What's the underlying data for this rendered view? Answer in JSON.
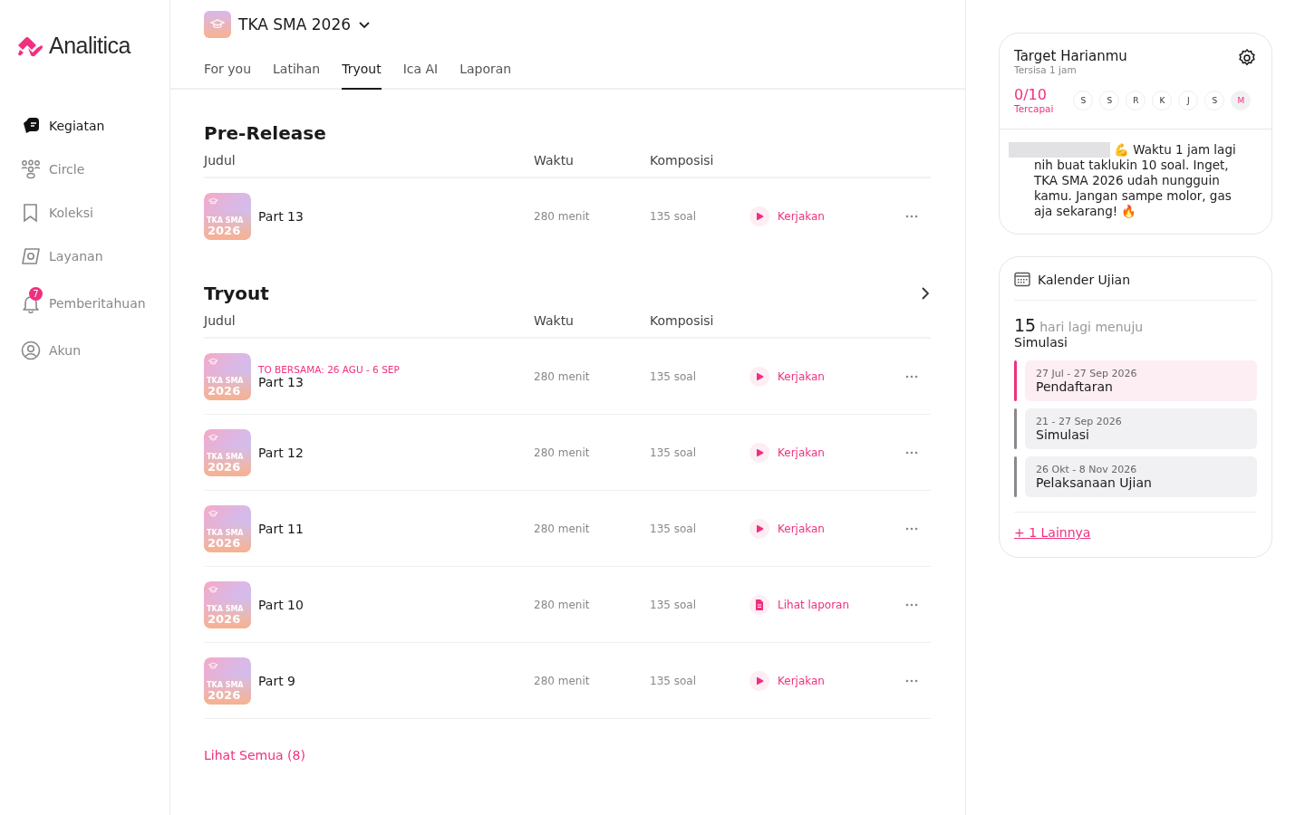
{
  "sidebar": {
    "logo": "Analitica",
    "items": [
      {
        "label": "Kegiatan",
        "kind": "cards",
        "selected": true
      },
      {
        "label": "Circle",
        "kind": "people",
        "selected": false
      },
      {
        "label": "Koleksi",
        "kind": "bookmark",
        "selected": false
      },
      {
        "label": "Layanan",
        "kind": "compass",
        "selected": false
      },
      {
        "label": "Pemberitahuan",
        "kind": "bell",
        "selected": false,
        "badge": "7"
      },
      {
        "label": "Akun",
        "kind": "user",
        "selected": false
      }
    ]
  },
  "header": {
    "program": "TKA SMA 2026",
    "tabs": [
      {
        "label": "For you",
        "selected": false
      },
      {
        "label": "Latihan",
        "selected": false
      },
      {
        "label": "Tryout",
        "selected": true
      },
      {
        "label": "Ica AI",
        "selected": false
      },
      {
        "label": "Laporan",
        "selected": false
      }
    ]
  },
  "sections": [
    {
      "title": "Pre-Release",
      "has_more": false,
      "columns": [
        "Judul",
        "Waktu",
        "Komposisi"
      ],
      "rows": [
        {
          "cover": {
            "label": "TKA SMA",
            "year": "2026"
          },
          "title": "Part 13",
          "time": "280 menit",
          "count": "135 soal",
          "action": {
            "kind": "play",
            "label": "Kerjakan"
          }
        }
      ]
    },
    {
      "title": "Tryout",
      "has_more": true,
      "columns": [
        "Judul",
        "Waktu",
        "Komposisi"
      ],
      "rows": [
        {
          "cover": {
            "label": "TKA SMA",
            "year": "2026"
          },
          "tag": "TO BERSAMA: 26 AGU - 6 SEP",
          "title": "Part 13",
          "time": "280 menit",
          "count": "135 soal",
          "action": {
            "kind": "play",
            "label": "Kerjakan"
          }
        },
        {
          "cover": {
            "label": "TKA SMA",
            "year": "2026"
          },
          "title": "Part 12",
          "time": "280 menit",
          "count": "135 soal",
          "action": {
            "kind": "play",
            "label": "Kerjakan"
          }
        },
        {
          "cover": {
            "label": "TKA SMA",
            "year": "2026"
          },
          "title": "Part 11",
          "time": "280 menit",
          "count": "135 soal",
          "action": {
            "kind": "play",
            "label": "Kerjakan"
          }
        },
        {
          "cover": {
            "label": "TKA SMA",
            "year": "2026"
          },
          "title": "Part 10",
          "time": "280 menit",
          "count": "135 soal",
          "action": {
            "kind": "report",
            "label": "Lihat laporan"
          }
        },
        {
          "cover": {
            "label": "TKA SMA",
            "year": "2026"
          },
          "title": "Part 9",
          "time": "280 menit",
          "count": "135 soal",
          "action": {
            "kind": "play",
            "label": "Kerjakan"
          }
        }
      ],
      "see_all": "Lihat Semua (8)"
    }
  ],
  "target": {
    "title": "Target Harianmu",
    "subtitle": "Tersisa 1 jam",
    "progress": "0/10",
    "progress_label": "Tercapai",
    "days": [
      {
        "label": "S",
        "selected": false
      },
      {
        "label": "S",
        "selected": false
      },
      {
        "label": "R",
        "selected": false
      },
      {
        "label": "K",
        "selected": false
      },
      {
        "label": "J",
        "selected": false
      },
      {
        "label": "S",
        "selected": false
      },
      {
        "label": "M",
        "selected": true
      }
    ],
    "message_lead": "💪 Waktu 1 jam lagi",
    "message": "nih buat taklukin 10 soal. Inget, TKA SMA 2026 udah nungguin kamu. Jangan sampe molor, gas aja sekarang! 🔥"
  },
  "calendar": {
    "title": "Kalender Ujian",
    "countdown": "15",
    "countdown_text": "hari lagi menuju",
    "countdown_target": "Simulasi",
    "events": [
      {
        "dates": "27 Jul - 27 Sep 2026",
        "name": "Pendaftaran",
        "color": "#f0307f"
      },
      {
        "dates": "21 - 27 Sep 2026",
        "name": "Simulasi",
        "color": "#8a8a8e"
      },
      {
        "dates": "26 Okt - 8 Nov 2026",
        "name": "Pelaksanaan Ujian",
        "color": "#8a8a8e"
      }
    ],
    "more": "+ 1 Lainnya"
  }
}
